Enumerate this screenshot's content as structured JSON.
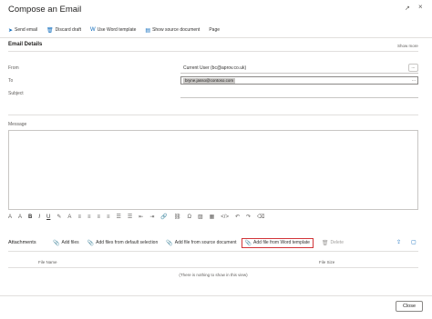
{
  "window": {
    "title": "Compose an Email",
    "expand_icon": "↗",
    "close_icon": "×"
  },
  "toolbar": {
    "items": [
      {
        "label": "Send email",
        "icon": "send-icon",
        "glyph": "➤"
      },
      {
        "label": "Discard draft",
        "icon": "trash-icon",
        "glyph": "🗑"
      },
      {
        "label": "Use Word template",
        "icon": "word-icon",
        "glyph": "W"
      },
      {
        "label": "Show source document",
        "icon": "document-icon",
        "glyph": "▤"
      },
      {
        "label": "Page",
        "icon": "",
        "glyph": ""
      }
    ]
  },
  "email_details": {
    "section_title": "Email Details",
    "show_more": "Show more",
    "from_label": "From",
    "from_value": "Current User (bc@aprov.co.uk)",
    "to_label": "To",
    "to_value": "bryne.jasso@contoso.com",
    "subject_label": "Subject",
    "subject_value": "",
    "message_label": "Message",
    "more_button": "..."
  },
  "format_toolbar": {
    "buttons": [
      {
        "name": "font-size-icon",
        "glyph": "A"
      },
      {
        "name": "font-family-icon",
        "glyph": "A"
      },
      {
        "name": "bold-button",
        "glyph": "B"
      },
      {
        "name": "italic-button",
        "glyph": "I"
      },
      {
        "name": "underline-button",
        "glyph": "U"
      },
      {
        "name": "highlight-icon",
        "glyph": "✎"
      },
      {
        "name": "font-color-icon",
        "glyph": "A"
      },
      {
        "name": "align-left-icon",
        "glyph": "≡"
      },
      {
        "name": "align-center-icon",
        "glyph": "≡"
      },
      {
        "name": "align-right-icon",
        "glyph": "≡"
      },
      {
        "name": "justify-icon",
        "glyph": "≡"
      },
      {
        "name": "bullet-list-icon",
        "glyph": "☰"
      },
      {
        "name": "numbered-list-icon",
        "glyph": "☰"
      },
      {
        "name": "decrease-indent-icon",
        "glyph": "⇤"
      },
      {
        "name": "increase-indent-icon",
        "glyph": "⇥"
      },
      {
        "name": "link-icon",
        "glyph": "🔗"
      },
      {
        "name": "unlink-icon",
        "glyph": "⛓"
      },
      {
        "name": "special-char-icon",
        "glyph": "Ω"
      },
      {
        "name": "image-icon",
        "glyph": "▨"
      },
      {
        "name": "table-icon",
        "glyph": "▦"
      },
      {
        "name": "code-icon",
        "glyph": "</>"
      },
      {
        "name": "undo-icon",
        "glyph": "↶"
      },
      {
        "name": "redo-icon",
        "glyph": "↷"
      },
      {
        "name": "clear-format-icon",
        "glyph": "⌫"
      }
    ]
  },
  "attachments": {
    "section_title": "Attachments",
    "items": [
      {
        "label": "Add files",
        "glyph": "📎",
        "highlight": false,
        "disabled": false
      },
      {
        "label": "Add files from default selection",
        "glyph": "📎",
        "highlight": false,
        "disabled": false
      },
      {
        "label": "Add file from source document",
        "glyph": "📎",
        "highlight": false,
        "disabled": false
      },
      {
        "label": "Add file from Word template",
        "glyph": "📎",
        "highlight": true,
        "disabled": false
      },
      {
        "label": "Delete",
        "glyph": "🗑",
        "highlight": false,
        "disabled": true
      }
    ],
    "share_icon": "⇪",
    "expand_icon": "▢",
    "col_file_name": "File Name",
    "col_file_size": "File Size",
    "empty_message": "(There is nothing to show in this view)"
  },
  "footer": {
    "close_label": "Close"
  },
  "colors": {
    "accent": "#0f6cbd",
    "highlight_border": "#d13438",
    "border": "#c8c6c4"
  }
}
